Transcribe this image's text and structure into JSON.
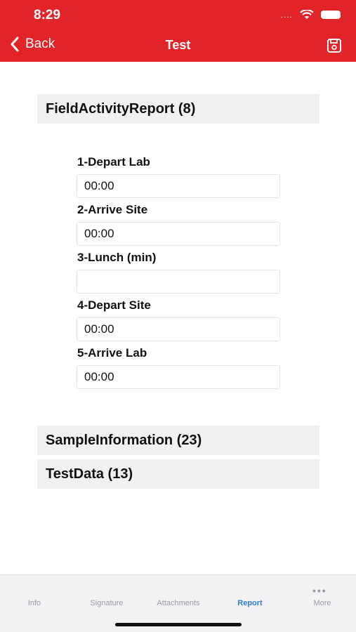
{
  "status_bar": {
    "time": "8:29",
    "signal": "...."
  },
  "nav": {
    "back_label": "Back",
    "title": "Test"
  },
  "sections": {
    "field_activity": "FieldActivityReport (8)",
    "sample_information": "SampleInformation (23)",
    "test_data": "TestData (13)"
  },
  "fields": [
    {
      "label": "1-Depart Lab",
      "value": "00:00"
    },
    {
      "label": "2-Arrive Site",
      "value": "00:00"
    },
    {
      "label": "3-Lunch (min)",
      "value": ""
    },
    {
      "label": "4-Depart Site",
      "value": "00:00"
    },
    {
      "label": "5-Arrive Lab",
      "value": "00:00"
    }
  ],
  "tabs": [
    {
      "label": "Info"
    },
    {
      "label": "Signature"
    },
    {
      "label": "Attachments"
    },
    {
      "label": "Report",
      "active": true
    },
    {
      "label": "More"
    }
  ],
  "colors": {
    "header": "#e02428",
    "tab_active": "#2b7bdc",
    "tab_inactive": "#9a9aa0"
  }
}
